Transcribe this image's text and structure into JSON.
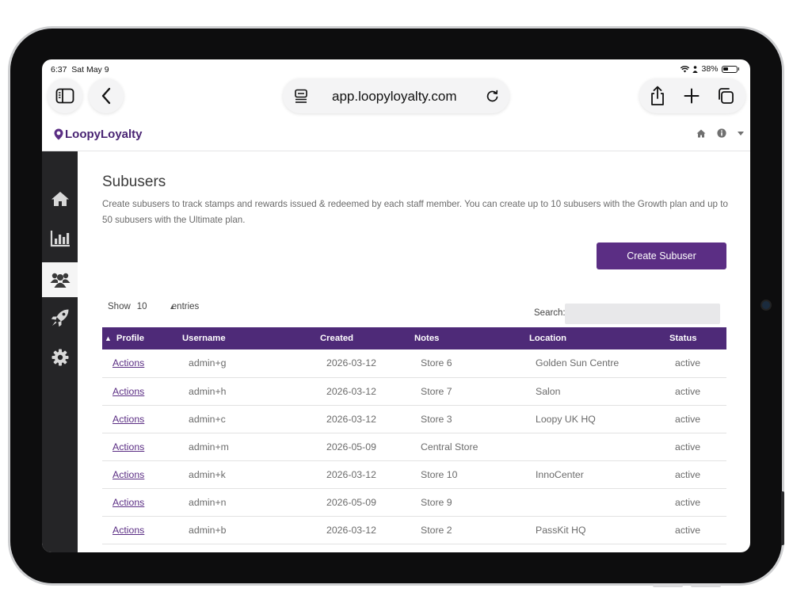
{
  "status_bar": {
    "time": "6:37",
    "date": "Sat May 9",
    "battery": "38%"
  },
  "browser": {
    "url": "app.loopyloyalty.com"
  },
  "app": {
    "logo_text": "LoopyLoyalty",
    "brand_color": "#5b2e84"
  },
  "page": {
    "title": "Subusers",
    "description": "Create subusers to track stamps and rewards issued & redeemed by each staff member. You can create up to 10 subusers with the Growth plan and up to 50 subusers with the Ultimate plan.",
    "create_button": "Create Subuser"
  },
  "table_controls": {
    "show_label": "Show",
    "entries_value": "10",
    "entries_label": "entries",
    "search_label": "Search:",
    "search_value": ""
  },
  "table": {
    "columns": [
      "Profile",
      "Username",
      "Created",
      "Notes",
      "Location",
      "Status"
    ],
    "rows": [
      {
        "profile": "Actions",
        "username": "admin+g",
        "created": "2026-03-12",
        "notes": "Store 6",
        "location": "Golden Sun Centre",
        "status": "active"
      },
      {
        "profile": "Actions",
        "username": "admin+h",
        "created": "2026-03-12",
        "notes": "Store 7",
        "location": "Salon",
        "status": "active"
      },
      {
        "profile": "Actions",
        "username": "admin+c",
        "created": "2026-03-12",
        "notes": "Store 3",
        "location": "Loopy UK HQ",
        "status": "active"
      },
      {
        "profile": "Actions",
        "username": "admin+m",
        "created": "2026-05-09",
        "notes": "Central Store",
        "location": "",
        "status": "active"
      },
      {
        "profile": "Actions",
        "username": "admin+k",
        "created": "2026-03-12",
        "notes": "Store 10",
        "location": "InnoCenter",
        "status": "active"
      },
      {
        "profile": "Actions",
        "username": "admin+n",
        "created": "2026-05-09",
        "notes": "Store 9",
        "location": "",
        "status": "active"
      },
      {
        "profile": "Actions",
        "username": "admin+b",
        "created": "2026-03-12",
        "notes": "Store 2",
        "location": "PassKit HQ",
        "status": "active"
      }
    ]
  },
  "sidebar": {
    "items": [
      {
        "icon": "home-icon",
        "active": false
      },
      {
        "icon": "bar-chart-icon",
        "active": false
      },
      {
        "icon": "users-icon",
        "active": true
      },
      {
        "icon": "rocket-icon",
        "active": false
      },
      {
        "icon": "gear-icon",
        "active": false
      }
    ]
  },
  "header_icons": [
    "home-icon",
    "info-icon",
    "caret-down-icon"
  ]
}
